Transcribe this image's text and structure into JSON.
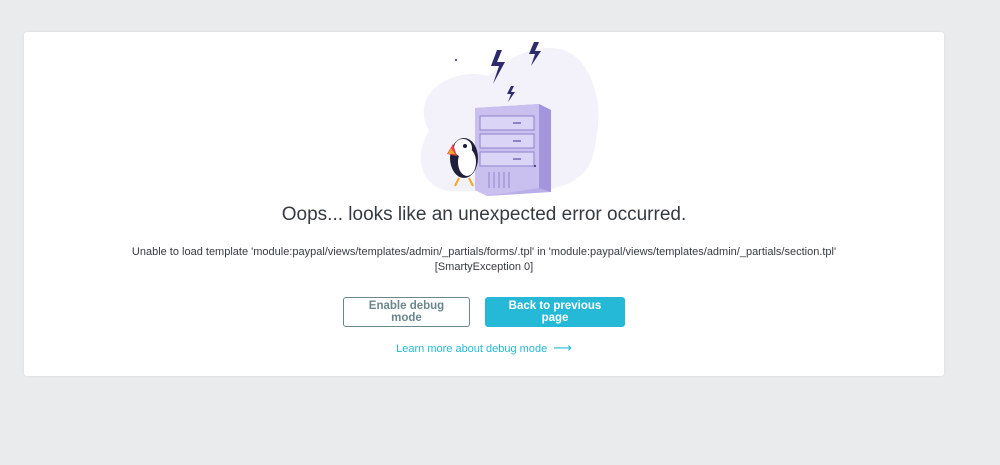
{
  "error": {
    "title": "Oops... looks like an unexpected error occurred.",
    "message_line1": "Unable to load template 'module:paypal/views/templates/admin/_partials/forms/.tpl' in 'module:paypal/views/templates/admin/_partials/section.tpl'",
    "message_line2": "[SmartyException 0]"
  },
  "actions": {
    "debug_button": "Enable debug mode",
    "back_button": "Back to previous page",
    "learn_more_link": "Learn more about debug mode",
    "learn_more_arrow": "⟶"
  },
  "illustration": {
    "name": "server-error-illustration"
  },
  "colors": {
    "accent": "#25b9d7",
    "outline": "#6c868e",
    "text": "#363a41",
    "background": "#eaebed"
  }
}
